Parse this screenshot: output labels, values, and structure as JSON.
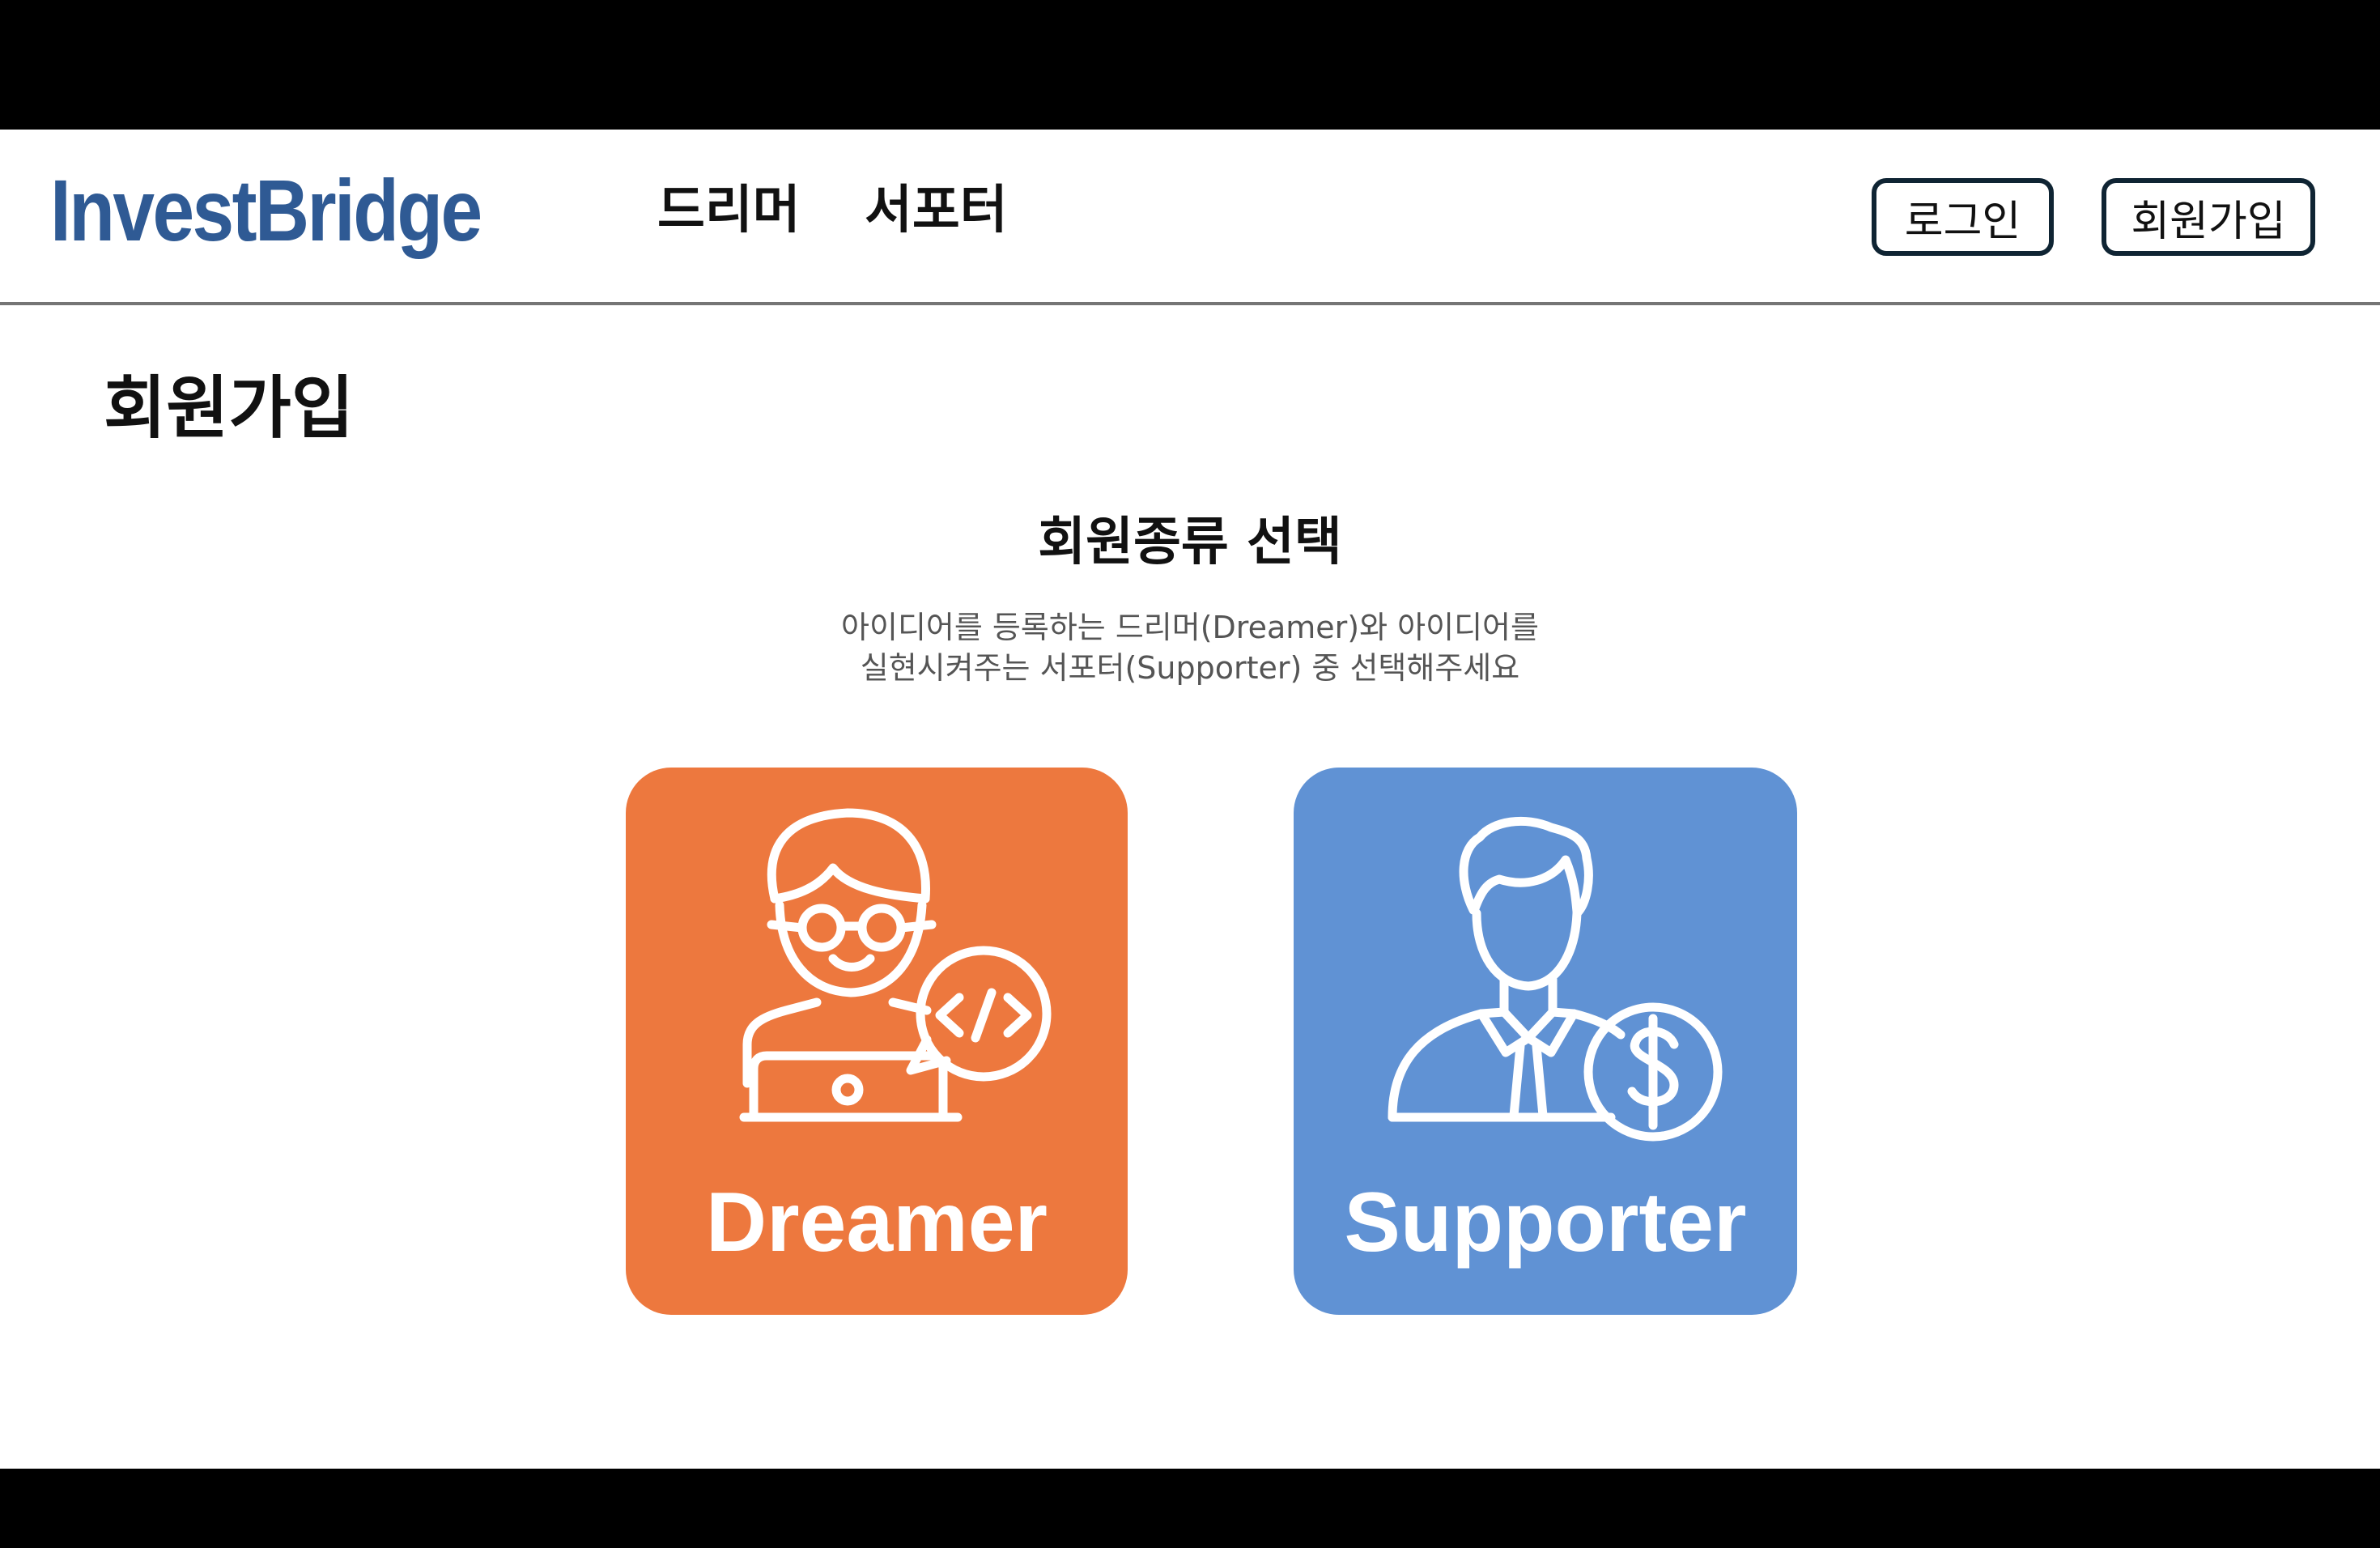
{
  "header": {
    "logo": "InvestBridge",
    "nav": [
      "드리머",
      "서포터"
    ],
    "login_label": "로그인",
    "signup_label": "회원가입"
  },
  "main": {
    "page_title": "회원가입",
    "section_title": "회원종류 선택",
    "description_line1": "아이디어를 등록하는 드리머(Dreamer)와 아이디어를",
    "description_line2": "실현시켜주는 서포터(Supporter) 중 선택해주세요",
    "cards": [
      {
        "label": "Dreamer",
        "icon": "developer-laptop-code-icon",
        "color": "#ED783E"
      },
      {
        "label": "Supporter",
        "icon": "businessman-dollar-icon",
        "color": "#6092D4"
      }
    ]
  },
  "colors": {
    "logo": "#2F5A94",
    "button_border": "#0F2433",
    "divider": "#757575",
    "letterbox": "#000000"
  }
}
